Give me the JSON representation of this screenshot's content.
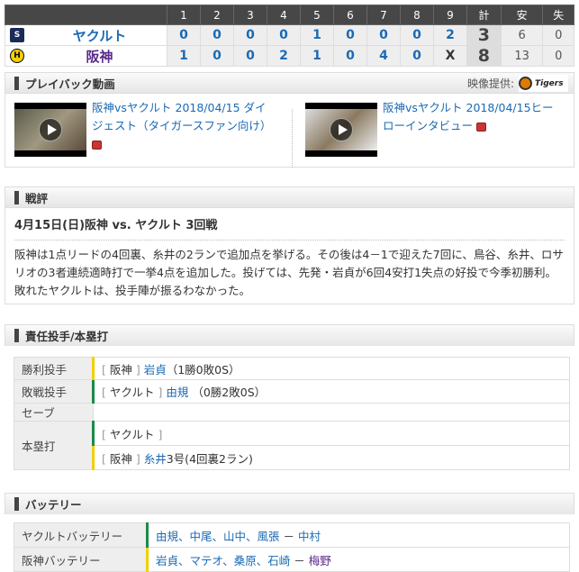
{
  "scoreboard": {
    "headers": [
      "1",
      "2",
      "3",
      "4",
      "5",
      "6",
      "7",
      "8",
      "9",
      "計",
      "安",
      "失"
    ],
    "teams": [
      {
        "name": "ヤクルト",
        "logo": "swallows-logo",
        "innings": [
          "0",
          "0",
          "0",
          "0",
          "1",
          "0",
          "0",
          "0",
          "2"
        ],
        "runs": "3",
        "hits": "6",
        "errors": "0",
        "color": "#1a6ab4"
      },
      {
        "name": "阪神",
        "logo": "tigers-logo",
        "innings": [
          "1",
          "0",
          "0",
          "2",
          "1",
          "0",
          "4",
          "0",
          "X"
        ],
        "runs": "8",
        "hits": "13",
        "errors": "0",
        "color": "#5a2a8a"
      }
    ]
  },
  "playback": {
    "title": "プレイバック動画",
    "credit": "映像提供:",
    "credit_logo": "Tigers",
    "videos": [
      {
        "title": "阪神vsヤクルト 2018/04/15 ダイジェスト（タイガースファン向け）"
      },
      {
        "title": "阪神vsヤクルト 2018/04/15ヒーローインタビュー"
      }
    ]
  },
  "review": {
    "title": "戦評",
    "game_title": "4月15日(日)阪神 vs. ヤクルト 3回戦",
    "body": "阪神は1点リードの4回裏、糸井の2ランで追加点を挙げる。その後は4－1で迎えた7回に、鳥谷、糸井、ロサリオの3者連続適時打で一挙4点を追加した。投げては、先発・岩貞が6回4安打1失点の好投で今季初勝利。敗れたヤクルトは、投手陣が振るわなかった。"
  },
  "pitchers": {
    "title": "責任投手/本塁打",
    "win": {
      "label": "勝利投手",
      "team": "阪神",
      "player": "岩貞",
      "record": "（1勝0敗0S）"
    },
    "loss": {
      "label": "敗戦投手",
      "team": "ヤクルト",
      "player": "由規",
      "record": "（0勝2敗0S）"
    },
    "save": {
      "label": "セーブ"
    },
    "hr": {
      "label": "本塁打",
      "rows": [
        {
          "team": "ヤクルト"
        },
        {
          "team": "阪神",
          "player": "糸井",
          "detail": "3号(4回裏2ラン)"
        }
      ]
    }
  },
  "battery": {
    "title": "バッテリー",
    "rows": [
      {
        "label": "ヤクルトバッテリー",
        "pitchers": "由規、中尾、山中、風張",
        "sep": " － ",
        "catcher": "中村"
      },
      {
        "label": "阪神バッテリー",
        "pitchers": "岩貞、マテオ、桑原、石崎",
        "sep": " － ",
        "catcher": "梅野"
      }
    ]
  }
}
